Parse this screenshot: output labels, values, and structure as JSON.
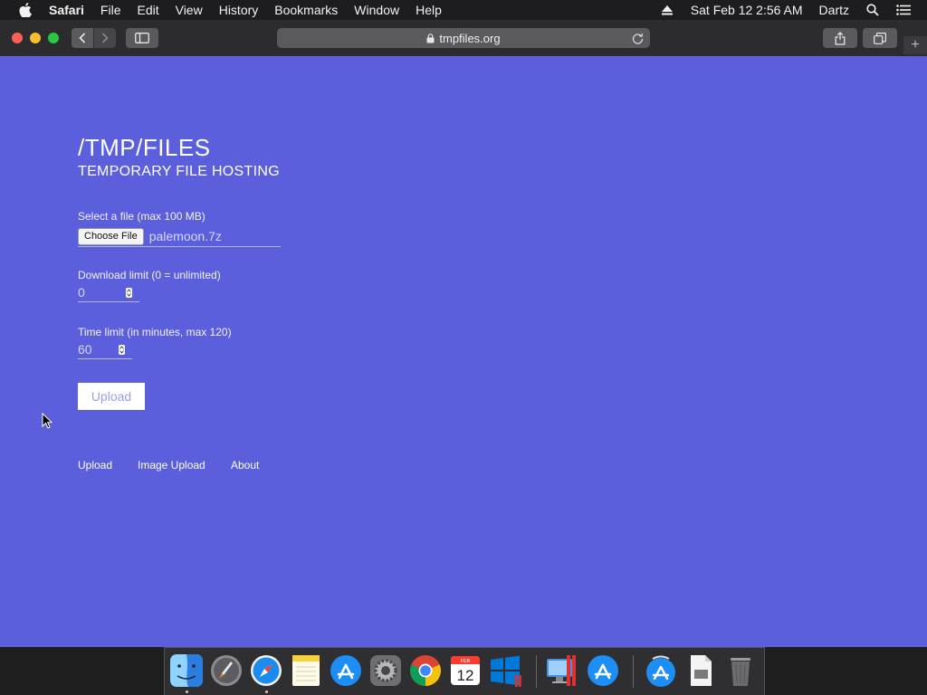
{
  "menubar": {
    "app_name": "Safari",
    "items": [
      "File",
      "Edit",
      "View",
      "History",
      "Bookmarks",
      "Window",
      "Help"
    ],
    "datetime": "Sat Feb 12  2:56 AM",
    "user": "Dartz"
  },
  "toolbar": {
    "url": "tmpfiles.org",
    "new_tab": "+"
  },
  "page": {
    "title": "/TMP/FILES",
    "subtitle": "TEMPORARY FILE HOSTING",
    "file_label": "Select a file (max 100 MB)",
    "choose_file_label": "Choose File",
    "selected_file": "palemoon.7z",
    "download_limit_label": "Download limit (0 = unlimited)",
    "download_limit_value": "0",
    "time_limit_label": "Time limit (in minutes, max 120)",
    "time_limit_value": "60",
    "upload_button": "Upload",
    "footer_links": [
      "Upload",
      "Image Upload",
      "About"
    ]
  },
  "dock": {
    "apps": [
      "finder-icon",
      "launchpad-icon",
      "safari-icon",
      "notes-icon",
      "app-store-icon",
      "system-preferences-icon",
      "chrome-icon",
      "calendar-icon",
      "windows-icon",
      "parallels-icon",
      "app-store-icon",
      "downloads-icon",
      "documents-icon",
      "trash-icon"
    ],
    "calendar_day": "12",
    "calendar_month": "FEB"
  },
  "colors": {
    "page_background": "#5c5fdc",
    "menubar_background": "#1d1d1f",
    "toolbar_background": "#2c2c2e"
  }
}
